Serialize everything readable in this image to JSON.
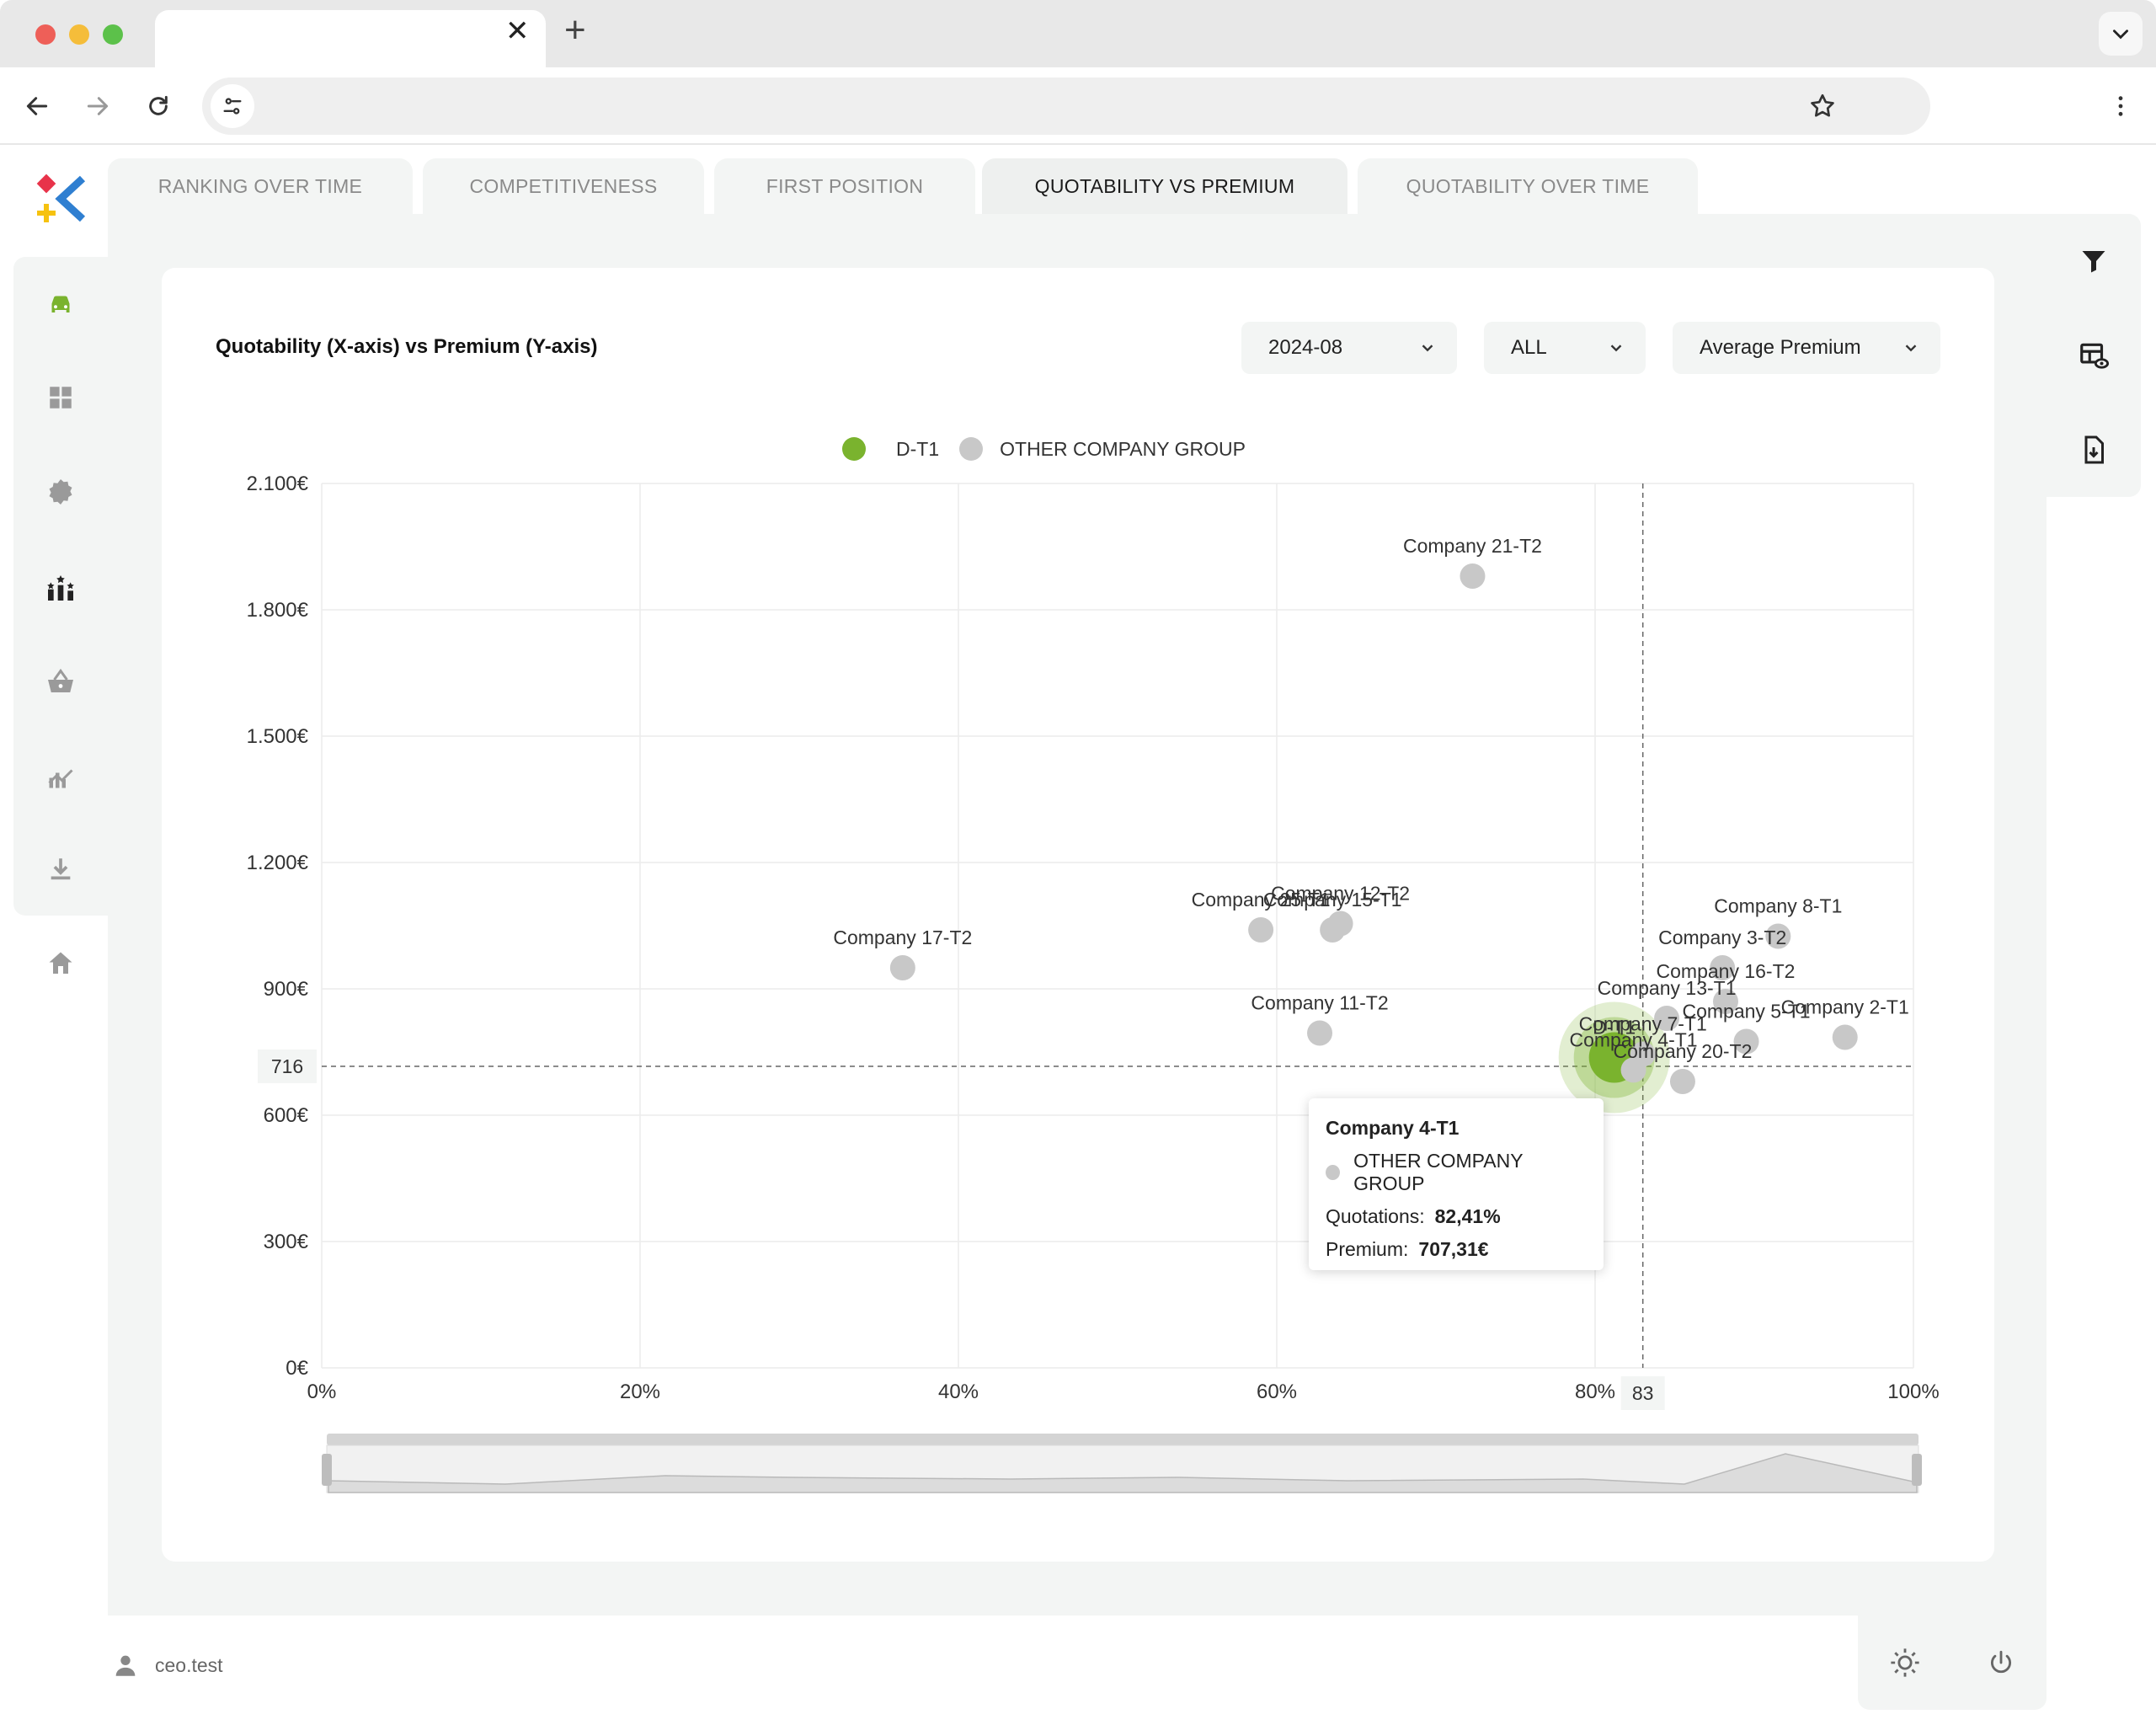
{
  "browser": {
    "tab_close_glyph": "✕",
    "tab_new_glyph": "+"
  },
  "tabs": [
    {
      "label": "RANKING OVER TIME"
    },
    {
      "label": "COMPETITIVENESS"
    },
    {
      "label": "FIRST POSITION"
    },
    {
      "label": "QUOTABILITY VS PREMIUM"
    },
    {
      "label": "QUOTABILITY OVER TIME"
    }
  ],
  "active_tab": "QUOTABILITY VS PREMIUM",
  "filters": {
    "period": "2024-08",
    "scope": "ALL",
    "metric": "Average Premium"
  },
  "colors": {
    "accent_green": "#7ab32e",
    "other_gray": "#c8c8c8",
    "logo_red": "#e8334a",
    "logo_yellow": "#f6c20f",
    "logo_blue": "#2f7fd1"
  },
  "user": {
    "name": "ceo.test"
  },
  "tooltip": {
    "title": "Company 4-T1",
    "series": "OTHER COMPANY GROUP",
    "quotations_label": "Quotations:",
    "quotations_value": "82,41%",
    "premium_label": "Premium:",
    "premium_value": "707,31€"
  },
  "chart_data": {
    "type": "scatter",
    "title": "Quotability (X-axis) vs Premium (Y-axis)",
    "legend": [
      {
        "name": "D-T1",
        "color": "#7ab32e"
      },
      {
        "name": "OTHER COMPANY GROUP",
        "color": "#c8c8c8"
      }
    ],
    "legend_position": "top-center",
    "xlim": [
      0,
      100
    ],
    "ylim": [
      0,
      2100
    ],
    "x_ticks": [
      "0%",
      "20%",
      "40%",
      "60%",
      "80%",
      "100%"
    ],
    "y_ticks": [
      "0€",
      "300€",
      "600€",
      "900€",
      "1.200€",
      "1.500€",
      "1.800€",
      "2.100€"
    ],
    "crosshair": {
      "x": 83,
      "y": 716,
      "x_label": "83",
      "y_label": "716"
    },
    "grid": true,
    "series": [
      {
        "name": "D-T1",
        "points": [
          {
            "label": "D-T1",
            "x": 81.2,
            "y": 737
          }
        ]
      },
      {
        "name": "OTHER COMPANY GROUP",
        "points": [
          {
            "label": "Company 21-T2",
            "x": 72.3,
            "y": 1880
          },
          {
            "label": "Company 12-T2",
            "x": 64.0,
            "y": 1055
          },
          {
            "label": "Company 15-T1",
            "x": 63.5,
            "y": 1040
          },
          {
            "label": "Company 25-T1",
            "x": 59.0,
            "y": 1040
          },
          {
            "label": "Company 17-T2",
            "x": 36.5,
            "y": 950
          },
          {
            "label": "Company 11-T2",
            "x": 62.7,
            "y": 795
          },
          {
            "label": "Company 8-T1",
            "x": 91.5,
            "y": 1025
          },
          {
            "label": "Company 3-T2",
            "x": 88.0,
            "y": 950
          },
          {
            "label": "Company 16-T2",
            "x": 88.2,
            "y": 870
          },
          {
            "label": "Company 13-T1",
            "x": 84.5,
            "y": 830
          },
          {
            "label": "Company 5-T1",
            "x": 89.5,
            "y": 775
          },
          {
            "label": "Company 2-T1",
            "x": 95.7,
            "y": 785
          },
          {
            "label": "Company 7-T1",
            "x": 83.0,
            "y": 745
          },
          {
            "label": "Company 4-T1",
            "x": 82.41,
            "y": 707.31
          },
          {
            "label": "Company 20-T2",
            "x": 85.5,
            "y": 680
          }
        ]
      }
    ]
  }
}
